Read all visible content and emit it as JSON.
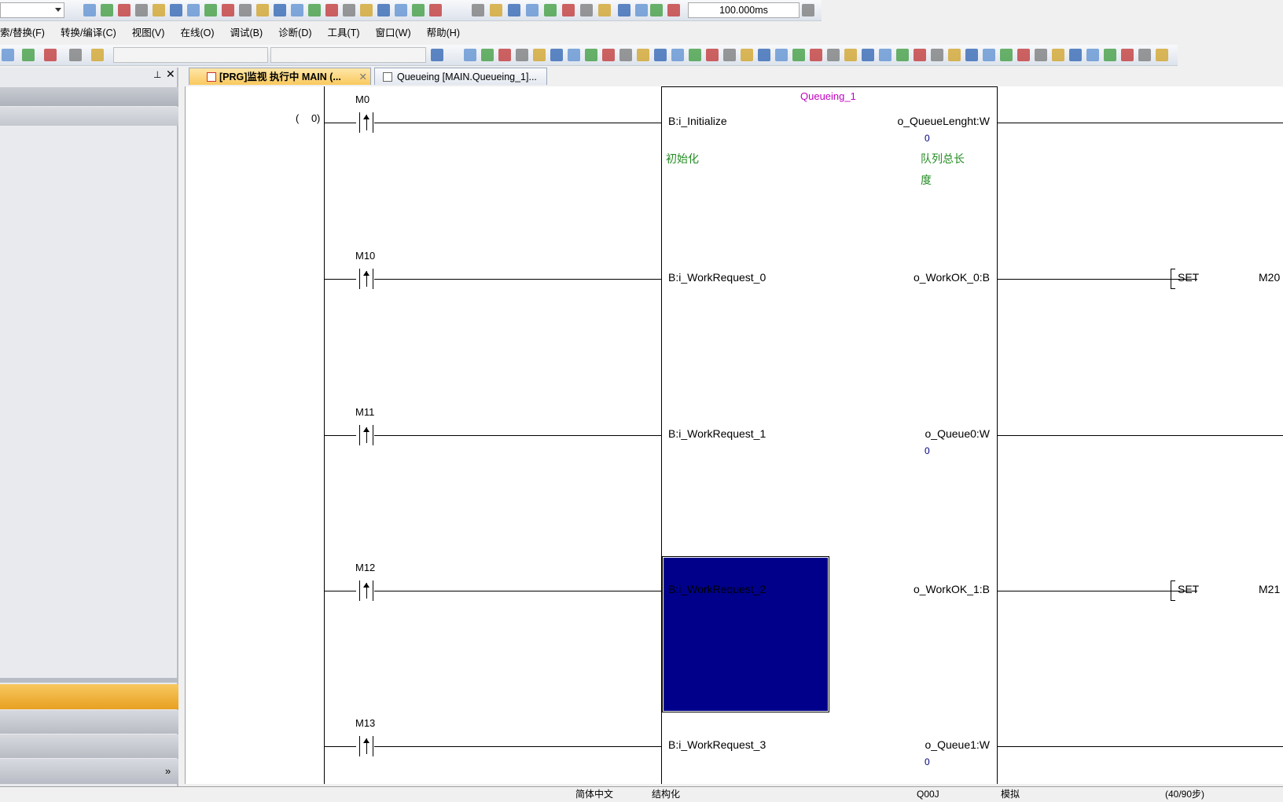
{
  "toolbar": {
    "scan_time": "100.000ms"
  },
  "menu": [
    "索/替换(F)",
    "转换/编译(C)",
    "视图(V)",
    "在线(O)",
    "调试(B)",
    "诊断(D)",
    "工具(T)",
    "窗口(W)",
    "帮助(H)"
  ],
  "tabs": [
    {
      "label": "[PRG]监视 执行中 MAIN (...",
      "active": true
    },
    {
      "label": "Queueing [MAIN.Queueing_1]...",
      "active": false
    }
  ],
  "ladder": {
    "step": "0",
    "fb_instance": "Queueing_1",
    "rows": [
      {
        "contact": "M0",
        "input": "B:i_Initialize",
        "output": "o_QueueLenght:W",
        "value": "0",
        "input_comment": "初始化",
        "output_comment": "队列总长",
        "output_comment2": "度"
      },
      {
        "contact": "M10",
        "input": "B:i_WorkRequest_0",
        "output": "o_WorkOK_0:B",
        "coil_cmd": "SET",
        "coil_dev": "M20"
      },
      {
        "contact": "M11",
        "input": "B:i_WorkRequest_1",
        "output": "o_Queue0:W",
        "value": "0"
      },
      {
        "contact": "M12",
        "input": "B:i_WorkRequest_2",
        "output": "o_WorkOK_1:B",
        "coil_cmd": "SET",
        "coil_dev": "M21"
      },
      {
        "contact": "M13",
        "input": "B:i_WorkRequest_3",
        "output": "o_Queue1:W",
        "value": "0"
      }
    ]
  },
  "status": {
    "language": "简体中文",
    "mode": "结构化",
    "cpu": "Q00J",
    "connection": "模拟",
    "steps": "(40/90步)"
  },
  "colors": {
    "selection": "#00008b",
    "fb_name": "#c000c0",
    "comment": "#228b22",
    "panel_highlight": "#f0b030"
  }
}
